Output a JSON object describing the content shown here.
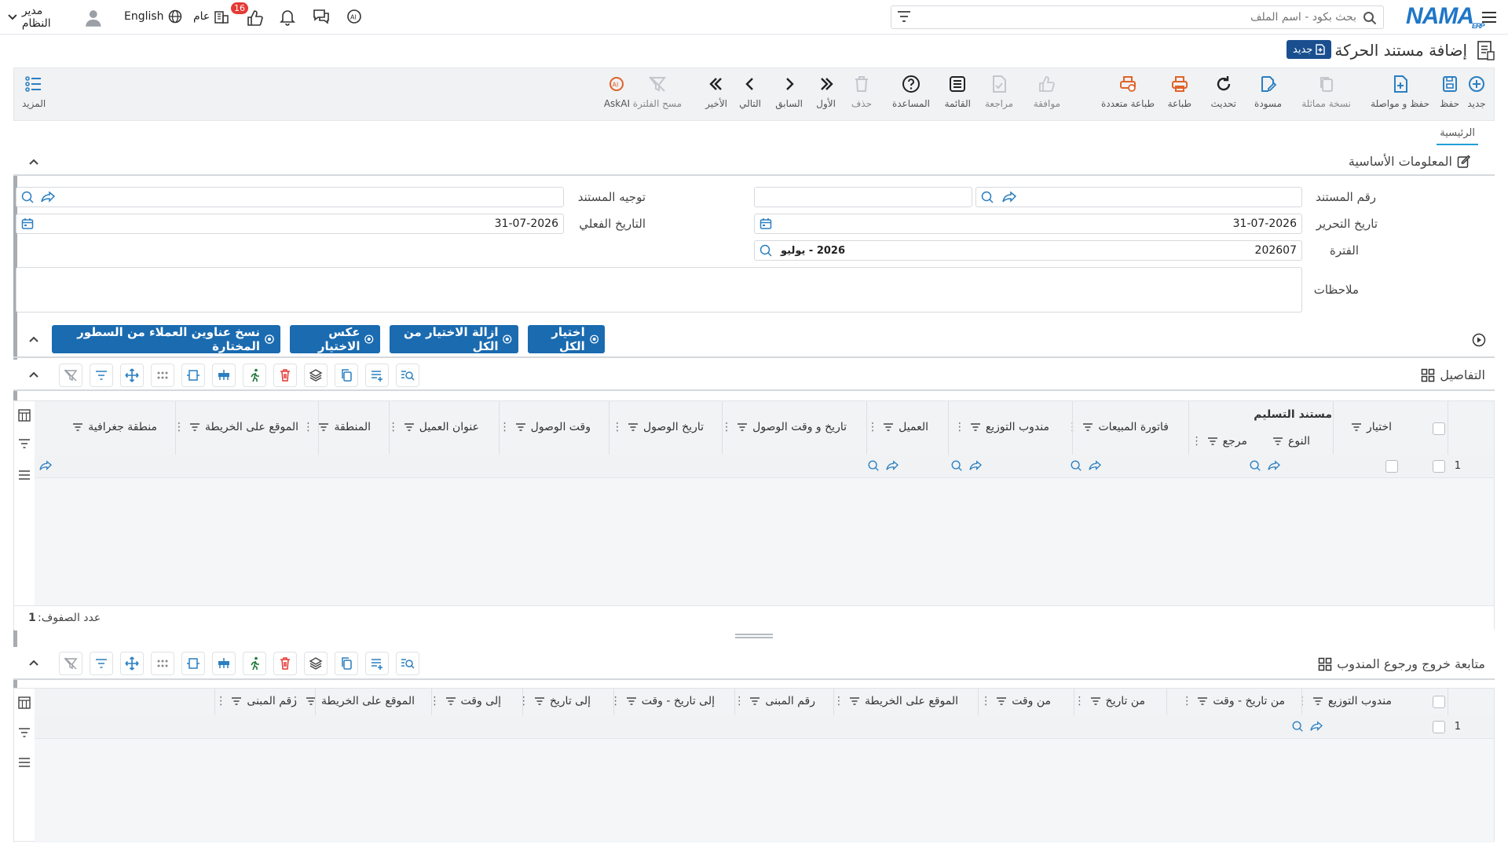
{
  "topbar": {
    "search_placeholder": "بحث بكود - اسم الملف",
    "logo": "NAMA",
    "logo_sub": "ERP",
    "user_name": "مدير النظام",
    "language": "English",
    "general_label": "عام",
    "notification_count": "16"
  },
  "header": {
    "title": "إضافة مستند الحركة",
    "new_badge": "جديد"
  },
  "toolbar": {
    "new": "جديد",
    "save": "حفظ",
    "save_continue": "حفظ و مواصلة",
    "duplicate": "نسخة مماثلة",
    "draft": "مسودة",
    "refresh": "تحديث",
    "print": "طباعة",
    "multi_print": "طباعة متعددة",
    "approve": "موافقة",
    "review": "مراجعة",
    "list": "القائمة",
    "help": "المساعدة",
    "delete": "حذف",
    "first": "الأول",
    "prev": "السابق",
    "next": "التالي",
    "last": "الأخير",
    "clear_filter": "مسح الفلترة",
    "askai": "AskAI",
    "more": "المزيد"
  },
  "tabs": {
    "main": "الرئيسية"
  },
  "basic_info": {
    "title": "المعلومات الأساسية",
    "doc_number_label": "رقم المستند",
    "doc_direction_label": "توجيه المستند",
    "edit_date_label": "تاريخ التحرير",
    "edit_date_value": "31-07-2026",
    "actual_date_label": "التاريخ الفعلي",
    "actual_date_value": "31-07-2026",
    "period_label": "الفترة",
    "period_value": "202607",
    "period_name": "2026 - يوليو",
    "notes_label": "ملاحظات"
  },
  "actions": {
    "select_all": "اختيار الكل",
    "unselect_all": "ازالة الاختيار من الكل",
    "invert": "عكس الاختيار",
    "copy_addresses": "نسخ عناوين العملاء من السطور المختارة"
  },
  "details": {
    "title": "التفاصيل",
    "group_header": "مستند التسليم",
    "columns": {
      "select": "اختيار",
      "type": "النوع",
      "ref": "مرجع",
      "sales_invoice": "فاتورة المبيعات",
      "dist_rep": "مندوب التوزيع",
      "customer": "العميل",
      "arrival_datetime": "تاريخ و وقت الوصول",
      "arrival_date": "تاريخ الوصول",
      "arrival_time": "وقت الوصول",
      "customer_address": "عنوان العميل",
      "region": "المنطقة",
      "map_location": "الموقع على الخريطة",
      "geo_area": "منطقة جغرافية"
    },
    "row_number": "1",
    "row_count_label": "عدد الصفوف:",
    "row_count": "1"
  },
  "tracking": {
    "title": "متابعة خروج ورجوع المندوب",
    "columns": {
      "dist_rep": "مندوب التوزيع",
      "from_datetime": "من تاريخ - وقت",
      "from_date": "من تاريخ",
      "from_time": "من وقت",
      "map_location": "الموقع على الخريطة",
      "building_no": "رقم المبنى",
      "to_datetime": "إلى تاريخ - وقت",
      "to_date": "إلى تاريخ",
      "to_time": "إلى وقت",
      "map_location2": "الموقع على الخريطة",
      "building_no2": "رقم المبنى"
    },
    "row_number": "1"
  },
  "colors": {
    "accent": "#1a6bb0",
    "brand": "#1f76c7",
    "icon_blue": "#2a7fc1",
    "orange": "#e0632a",
    "badge_red": "#e53935"
  }
}
